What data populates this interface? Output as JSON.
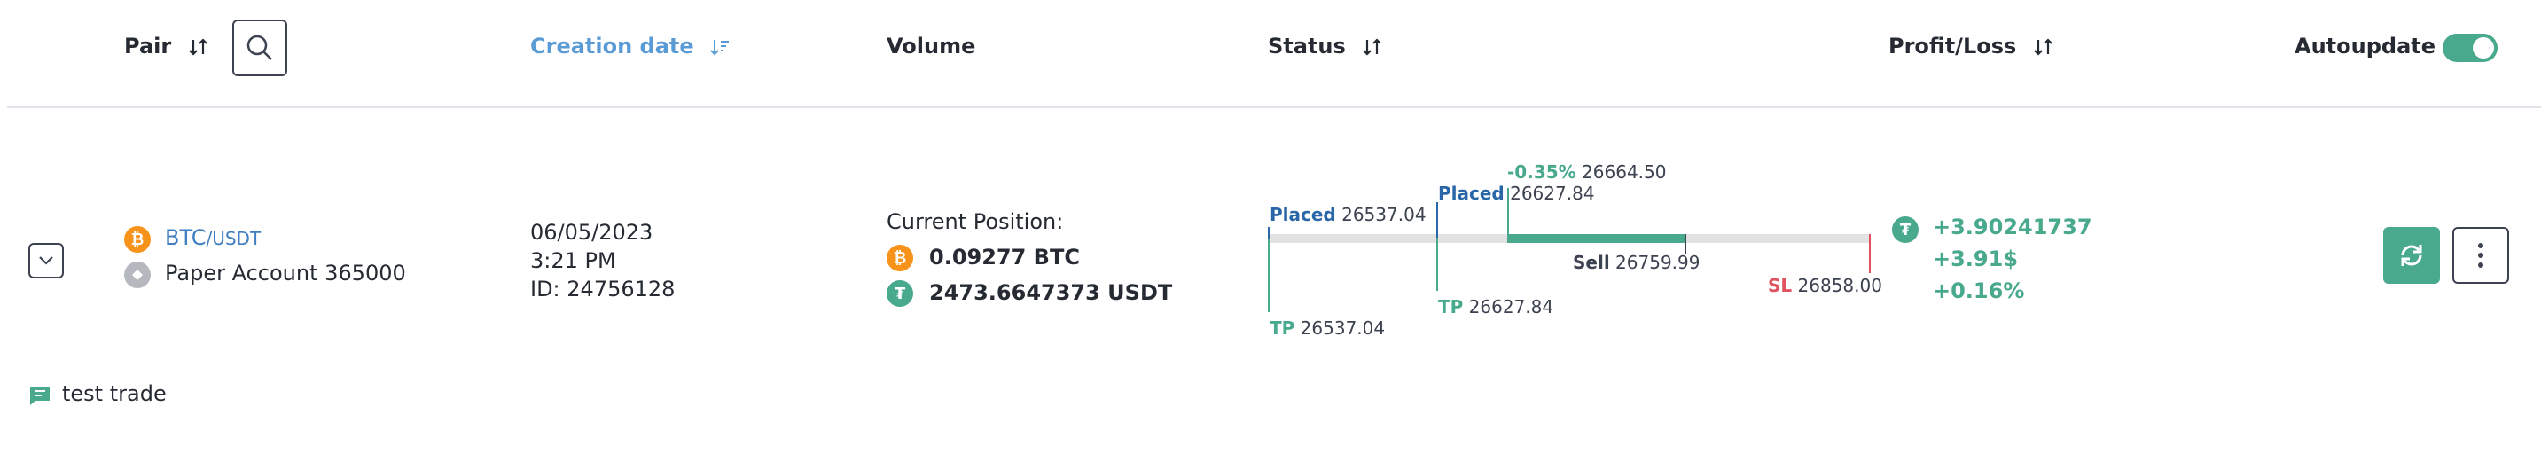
{
  "header": {
    "pair_label": "Pair",
    "creation_date_label": "Creation date",
    "volume_label": "Volume",
    "status_label": "Status",
    "profit_loss_label": "Profit/Loss",
    "autoupdate_label": "Autoupdate",
    "autoupdate_on": true
  },
  "trade": {
    "base": "BTC",
    "quote": "/USDT",
    "account": "Paper Account 365000",
    "date": "06/05/2023",
    "time": "3:21 PM",
    "id": "ID: 24756128",
    "volume_title": "Current Position:",
    "volume_btc": "0.09277 BTC",
    "volume_usdt": "2473.6647373 USDT",
    "note": "test trade",
    "colors": {
      "btc": "#f7931a",
      "usdt": "#48a98d",
      "accent": "#48a98d",
      "stop": "#e05260",
      "placed": "#2a67a8"
    }
  },
  "status": {
    "placed1_tag": "Placed",
    "placed1_value": "26537.04",
    "placed2_tag": "Placed",
    "placed2_value": "26627.84",
    "current_change": "-0.35%",
    "current_value": "26664.50",
    "sell_tag": "Sell",
    "sell_value": "26759.99",
    "sl_tag": "SL",
    "sl_value": "26858.00",
    "tp1_tag": "TP",
    "tp1_value": "26537.04",
    "tp2_tag": "TP",
    "tp2_value": "26627.84"
  },
  "profit": {
    "amount": "+3.90241737",
    "usd": "+3.91$",
    "percent": "+0.16%"
  }
}
